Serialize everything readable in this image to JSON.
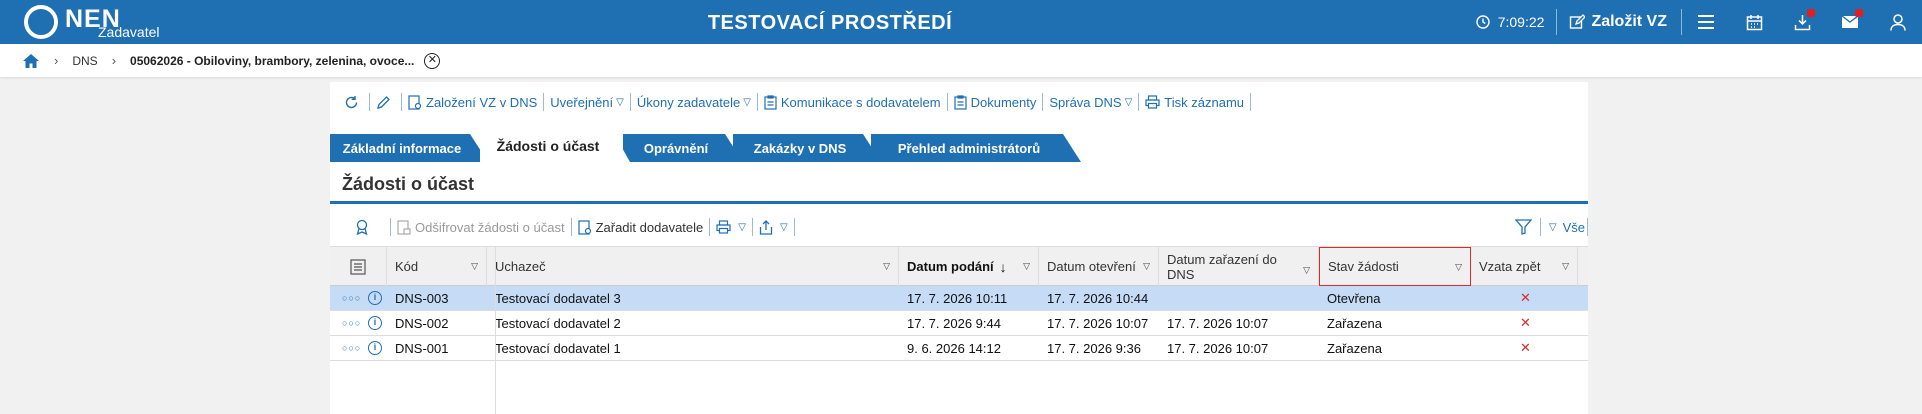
{
  "header": {
    "logo_text": "NEN",
    "logo_sub": "Zadavatel",
    "env_title": "TESTOVACÍ PROSTŘEDÍ",
    "clock": "7:09:22",
    "create_label": "Založit VZ"
  },
  "breadcrumb": {
    "items": [
      "DNS"
    ],
    "current": "05062026 - Obiloviny, brambory, zelenina, ovoce..."
  },
  "toolbar": {
    "items": [
      {
        "label": "Založení VZ v DNS",
        "caret": ""
      },
      {
        "label": "Uveřejnění",
        "caret": "▽"
      },
      {
        "label": "Úkony zadavatele",
        "caret": "▽"
      },
      {
        "label": "Komunikace s dodavatelem",
        "caret": ""
      },
      {
        "label": "Dokumenty",
        "caret": ""
      },
      {
        "label": "Správa DNS",
        "caret": "▽"
      },
      {
        "label": "Tisk záznamu",
        "caret": ""
      }
    ]
  },
  "tabs": [
    {
      "label": "Základní informace",
      "active": false
    },
    {
      "label": "Žádosti o účast",
      "active": true
    },
    {
      "label": "Oprávnění",
      "active": false
    },
    {
      "label": "Zakázky v DNS",
      "active": false
    },
    {
      "label": "Přehled administrátorů",
      "active": false
    }
  ],
  "section": {
    "title": "Žádosti o účast"
  },
  "toolbar2": {
    "decrypt_label": "Odšifrovat žádosti o účast",
    "assign_label": "Zařadit dodavatele",
    "all_label": "Vše"
  },
  "table": {
    "columns": [
      "Kód",
      "Uchazeč",
      "Datum podání",
      "Datum otevření",
      "Datum zařazení do DNS",
      "Stav žádosti",
      "Vzata zpět"
    ],
    "rows": [
      {
        "kod": "DNS-003",
        "uchazec": "Testovací dodavatel 3",
        "podani": "17. 7. 2026 10:11",
        "otevreni": "17. 7. 2026 10:44",
        "zarazeni": "",
        "stav": "Otevřena",
        "zpet": "✕",
        "selected": true
      },
      {
        "kod": "DNS-002",
        "uchazec": "Testovací dodavatel 2",
        "podani": "17. 7. 2026 9:44",
        "otevreni": "17. 7. 2026 10:07",
        "zarazeni": "17. 7. 2026 10:07",
        "stav": "Zařazena",
        "zpet": "✕",
        "selected": false
      },
      {
        "kod": "DNS-001",
        "uchazec": "Testovací dodavatel 1",
        "podani": "9. 6. 2026 14:12",
        "otevreni": "17. 7. 2026 9:36",
        "zarazeni": "17. 7. 2026 10:07",
        "stav": "Zařazena",
        "zpet": "✕",
        "selected": false
      }
    ]
  },
  "colors": {
    "primary": "#1f6fb3",
    "selected_row": "#c5dbf6",
    "alert": "#d62c2c"
  }
}
